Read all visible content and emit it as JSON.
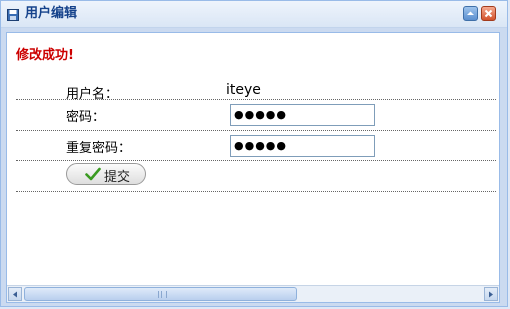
{
  "window": {
    "title": "用户编辑",
    "icons": {
      "title": "save-icon",
      "collapse": "collapse-icon",
      "close": "close-icon"
    }
  },
  "message": {
    "success_text": "修改成功!",
    "color": "#cc0000"
  },
  "form": {
    "username_label": "用户名：",
    "username_value": "iteye",
    "password_label": "密码：",
    "password_value": "●●●●●",
    "confirm_label": "重复密码：",
    "confirm_value": "●●●●●"
  },
  "submit": {
    "label": "提交",
    "icon": "check-icon"
  },
  "colors": {
    "title_text": "#15428b",
    "panel_border": "#99bbe8"
  }
}
